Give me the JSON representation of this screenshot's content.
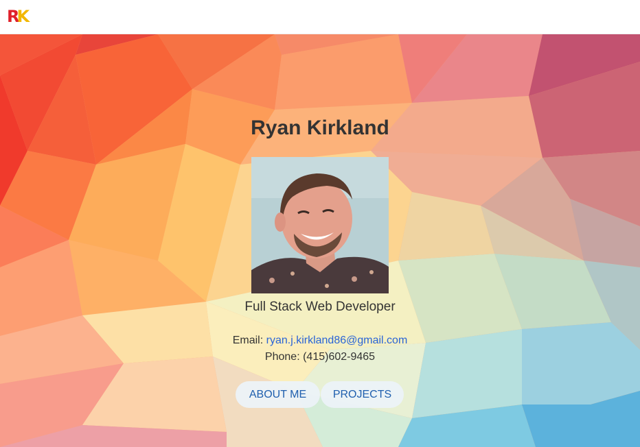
{
  "navbar": {
    "logo_letter_1": "R",
    "logo_letter_2": "K"
  },
  "profile": {
    "name": "Ryan Kirkland",
    "photo_alt": "Ryan Kirkland",
    "title": "Full Stack Web Developer",
    "email_label": "Email:",
    "email": "ryan.j.kirkland86@gmail.com",
    "phone_label": "Phone:",
    "phone": "(415)602-9465"
  },
  "buttons": {
    "about": "ABOUT ME",
    "projects": "PROJECTS"
  },
  "colors": {
    "logo_r": "#e0202a",
    "logo_k": "#f2b700",
    "link": "#2a64d6",
    "button_text": "#1f5fae"
  }
}
